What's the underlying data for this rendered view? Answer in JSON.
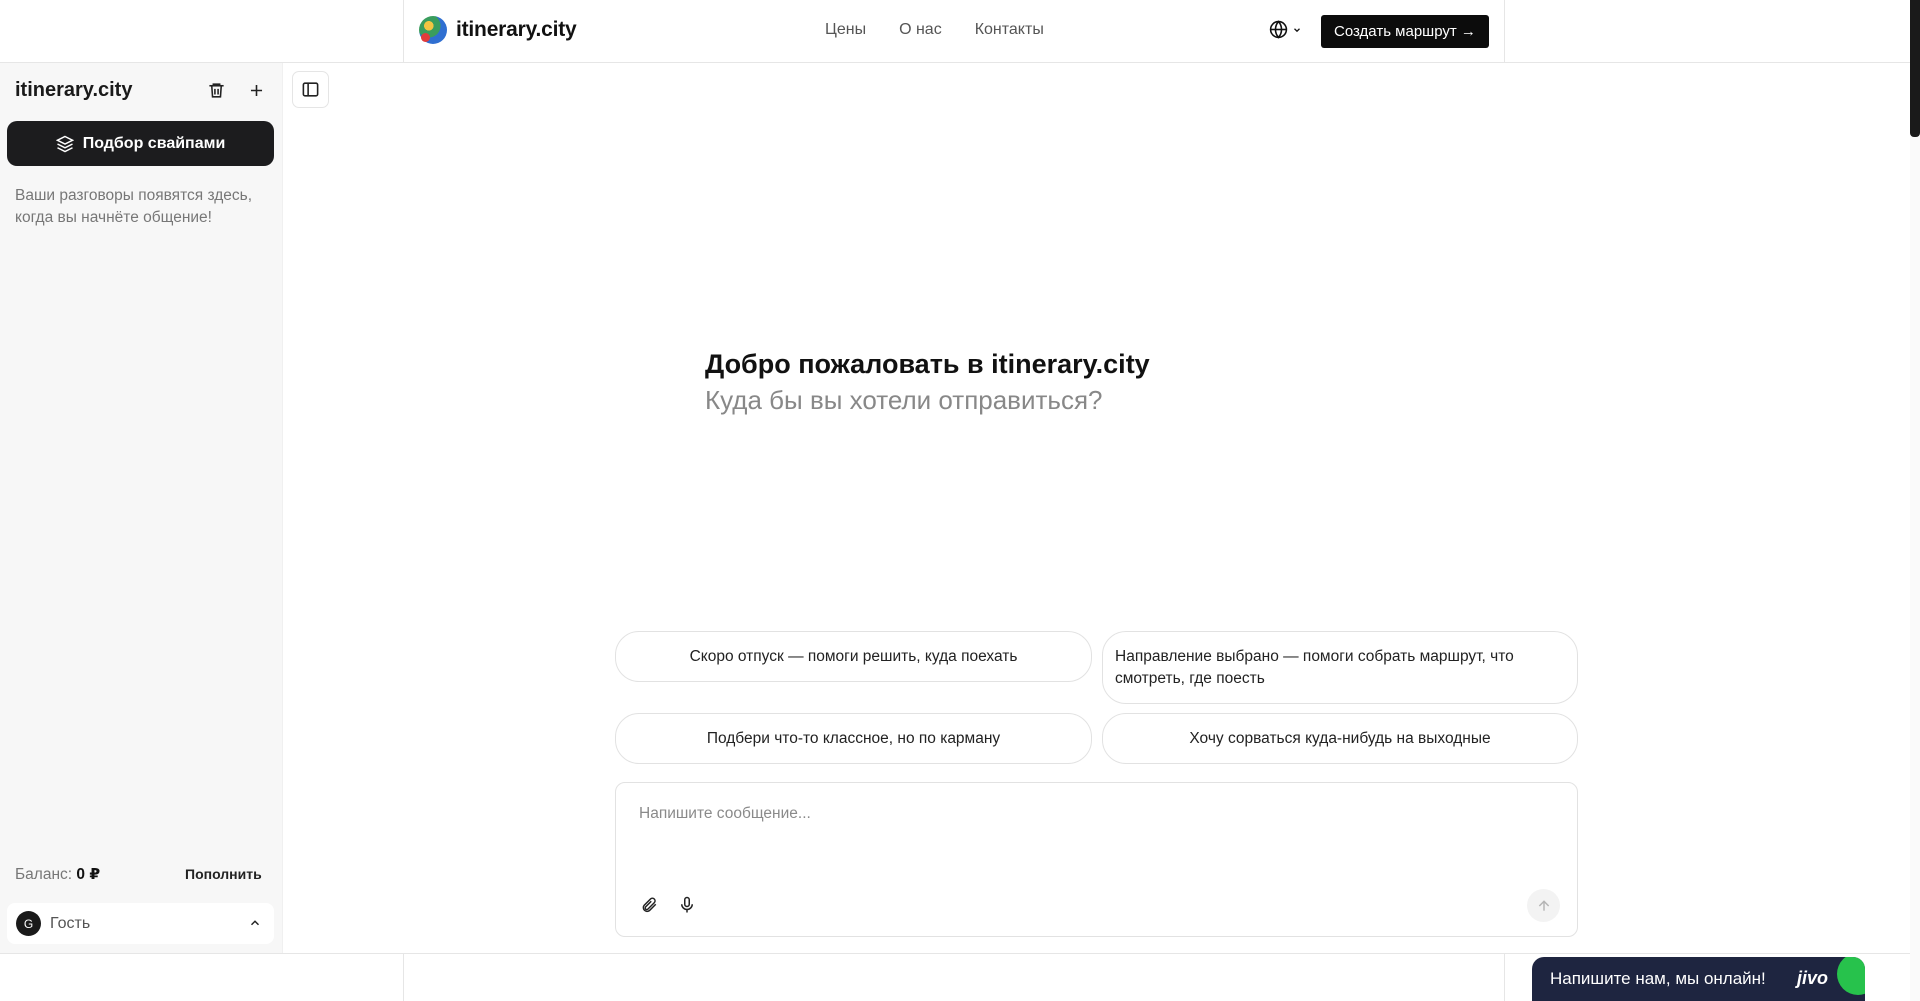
{
  "header": {
    "brand": "itinerary.city",
    "nav": [
      "Цены",
      "О нас",
      "Контакты"
    ],
    "cta_label": "Создать маршрут →"
  },
  "sidebar": {
    "title": "itinerary.city",
    "swipe_label": "Подбор свайпами",
    "empty_text": "Ваши разговоры появятся здесь, когда вы начнёте общение!",
    "balance_label": "Баланс:",
    "balance_value": "0 ₽",
    "topup_label": "Пополнить",
    "user_initial": "G",
    "user_name": "Гость"
  },
  "main": {
    "welcome_title": "Добро пожаловать в itinerary.city",
    "welcome_sub": "Куда бы вы хотели отправиться?",
    "suggestions": [
      "Скоро отпуск — помоги решить, куда поехать",
      "Направление выбрано — помоги собрать маршрут, что смотреть, где поесть",
      "Подбери что-то классное, но по карману",
      "Хочу сорваться куда-нибудь на выходные"
    ],
    "composer_placeholder": "Напишите сообщение..."
  },
  "chat_widget": {
    "text": "Напишите нам, мы онлайн!",
    "logo": "jivo"
  },
  "icons": {
    "globe": "globe-icon",
    "trash": "trash-icon",
    "plus": "plus-icon",
    "layers": "layers-icon",
    "sidebar_toggle": "sidebar-toggle-icon",
    "attach": "paperclip-icon",
    "mic": "microphone-icon",
    "send": "arrow-up-icon"
  },
  "colors": {
    "primary_dark": "#0c0c0c",
    "sidebar_bg": "#f7f7f7",
    "widget_bg": "#1e2540",
    "widget_accent": "#27c24c"
  }
}
